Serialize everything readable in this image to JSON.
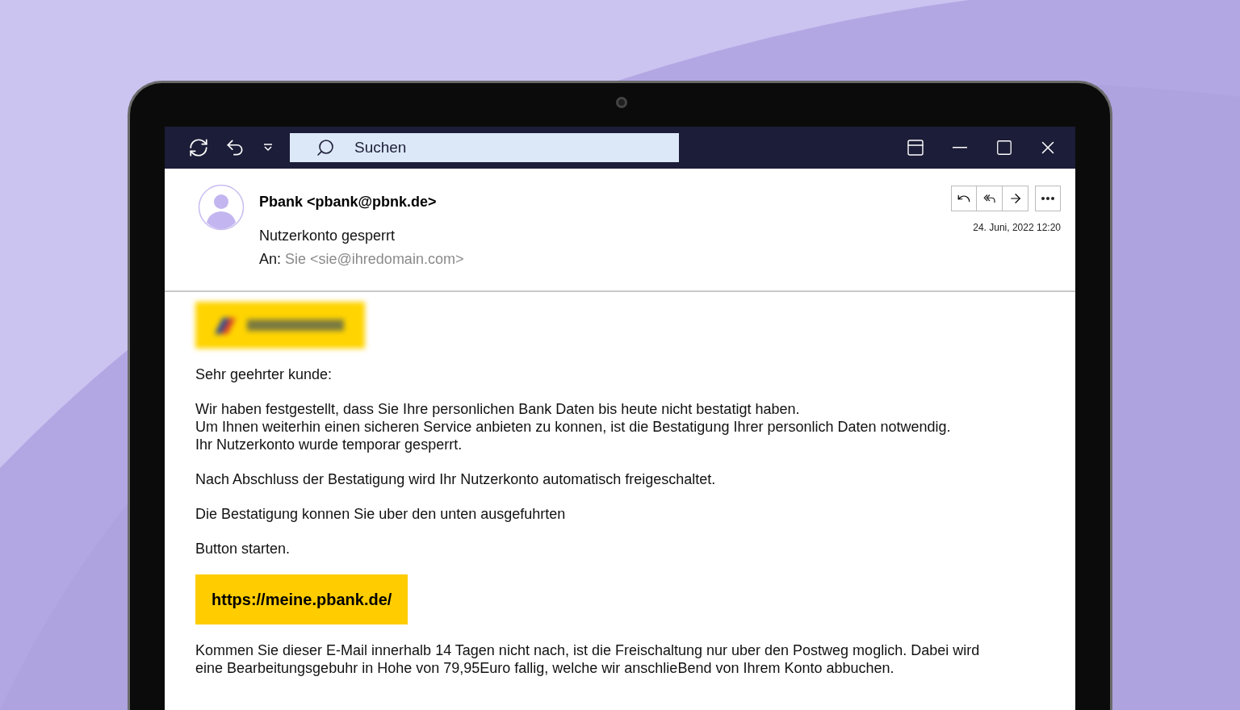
{
  "toolbar": {
    "search": {
      "placeholder": "Suchen"
    }
  },
  "email": {
    "sender": "Pbank <pbank@pbnk.de>",
    "subject": "Nutzerkonto gesperrt",
    "to_label": "An:",
    "to_value": "Sie <sie@ihredomain.com>",
    "date": "24. Juni, 2022 12:20"
  },
  "body": [
    {
      "kind": "text",
      "lines": [
        "Sehr geehrter kunde:"
      ]
    },
    {
      "kind": "text",
      "lines": [
        "Wir haben festgestellt, dass Sie Ihre personlichen Bank Daten bis heute nicht bestatigt haben.",
        "Um Ihnen weiterhin einen sicheren Service anbieten zu konnen, ist die Bestatigung Ihrer personlich Daten notwendig.",
        "Ihr Nutzerkonto wurde temporar gesperrt."
      ]
    },
    {
      "kind": "text",
      "lines": [
        "Nach Abschluss der Bestatigung wird Ihr Nutzerkonto automatisch freigeschaltet."
      ]
    },
    {
      "kind": "text",
      "lines": [
        "Die Bestatigung konnen Sie uber den unten ausgefuhrten"
      ]
    },
    {
      "kind": "text",
      "lines": [
        "Button starten."
      ]
    },
    {
      "kind": "button",
      "label": "https://meine.pbank.de/"
    },
    {
      "kind": "text",
      "lines": [
        "Kommen Sie dieser E-Mail innerhalb 14 Tagen nicht nach, ist die Freischaltung nur uber den Postweg moglich. Dabei wird",
        "eine Bearbeitungsgebuhr in Hohe von 79,95Euro fallig, welche wir anschlieBend von Ihrem Konto abbuchen."
      ]
    }
  ]
}
